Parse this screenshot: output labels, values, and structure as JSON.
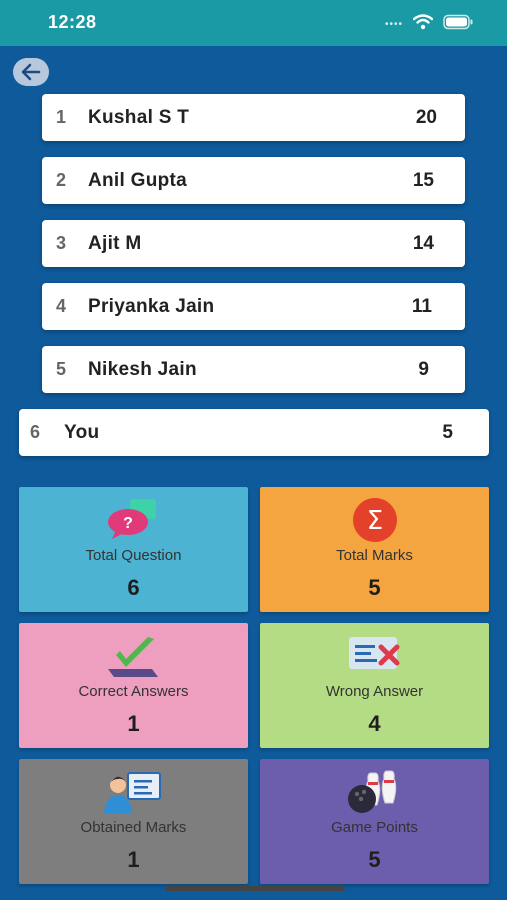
{
  "status_bar": {
    "time": "12:28"
  },
  "leaderboard": [
    {
      "rank": "1",
      "name": "Kushal S T",
      "score": "20"
    },
    {
      "rank": "2",
      "name": "Anil Gupta",
      "score": "15"
    },
    {
      "rank": "3",
      "name": "Ajit M",
      "score": "14"
    },
    {
      "rank": "4",
      "name": "Priyanka Jain",
      "score": "11"
    },
    {
      "rank": "5",
      "name": "Nikesh Jain",
      "score": "9"
    }
  ],
  "current_user": {
    "rank": "6",
    "name": "You",
    "score": "5"
  },
  "stats": [
    {
      "label": "Total Question",
      "value": "6",
      "icon": "question-chat-icon",
      "color": "#4db3d2"
    },
    {
      "label": "Total Marks",
      "value": "5",
      "icon": "sigma-icon",
      "color": "#f5a540"
    },
    {
      "label": "Correct Answers",
      "value": "1",
      "icon": "checkmark-icon",
      "color": "#ee9fc0"
    },
    {
      "label": "Wrong Answer",
      "value": "4",
      "icon": "wrong-mark-icon",
      "color": "#b4dc84"
    },
    {
      "label": "Obtained Marks",
      "value": "1",
      "icon": "person-board-icon",
      "color": "#7e7e7e"
    },
    {
      "label": "Game Points",
      "value": "5",
      "icon": "bowling-icon",
      "color": "#6c5eac"
    }
  ],
  "colors": {
    "background": "#0e5a9a",
    "status_bar": "#1a9aa4"
  }
}
